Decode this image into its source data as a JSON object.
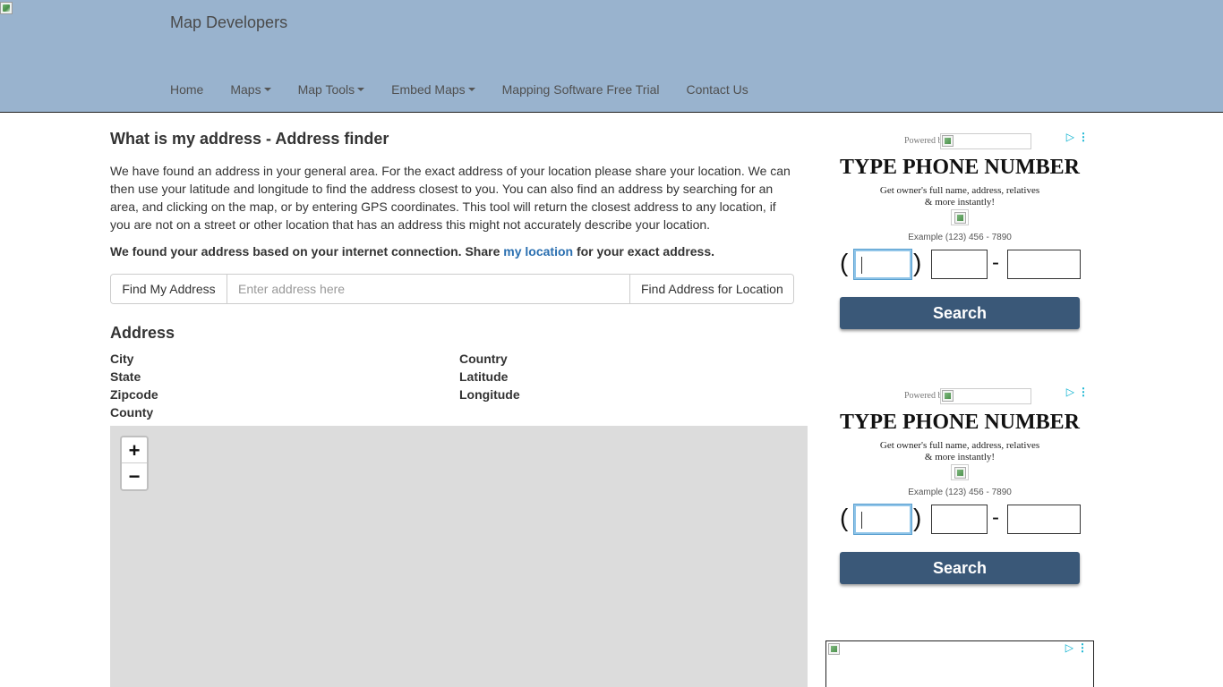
{
  "header": {
    "brand": "Map Developers",
    "nav": [
      {
        "label": "Home",
        "dropdown": false
      },
      {
        "label": "Maps",
        "dropdown": true
      },
      {
        "label": "Map Tools",
        "dropdown": true
      },
      {
        "label": "Embed Maps",
        "dropdown": true
      },
      {
        "label": "Mapping Software Free Trial",
        "dropdown": false
      },
      {
        "label": "Contact Us",
        "dropdown": false
      }
    ]
  },
  "main": {
    "title": "What is my address - Address finder",
    "intro": "We have found an address in your general area. For the exact address of your location please share your location. We can then use your latitude and longitude to find the address closest to you. You can also find an address by searching for an area, and clicking on the map, or by entering GPS coordinates. This tool will return the closest address to any location, if you are not on a street or other location that has an address this might not accurately describe your location.",
    "share_prefix": "We found your address based on your internet connection. Share",
    "share_link": "my location",
    "share_suffix": "for your exact address.",
    "find_my_address": "Find My Address",
    "address_placeholder": "Enter address here",
    "find_for_location": "Find Address for Location",
    "address_heading": "Address",
    "fields": {
      "city": "City",
      "state": "State",
      "zipcode": "Zipcode",
      "county": "County",
      "country": "Country",
      "latitude": "Latitude",
      "longitude": "Longitude"
    },
    "zoom_in": "+",
    "zoom_out": "−"
  },
  "ads": {
    "adchoices_icon": "▷",
    "menu_icon": "⋮",
    "powered": "Powered b",
    "title": "TYPE PHONE NUMBER",
    "sub_line1": "Get owner's full name, address, relatives",
    "sub_line2": "& more instantly!",
    "example": "Example (123) 456 - 7890",
    "open_paren": "(",
    "close_paren": ")",
    "dash": "-",
    "search": "Search"
  }
}
